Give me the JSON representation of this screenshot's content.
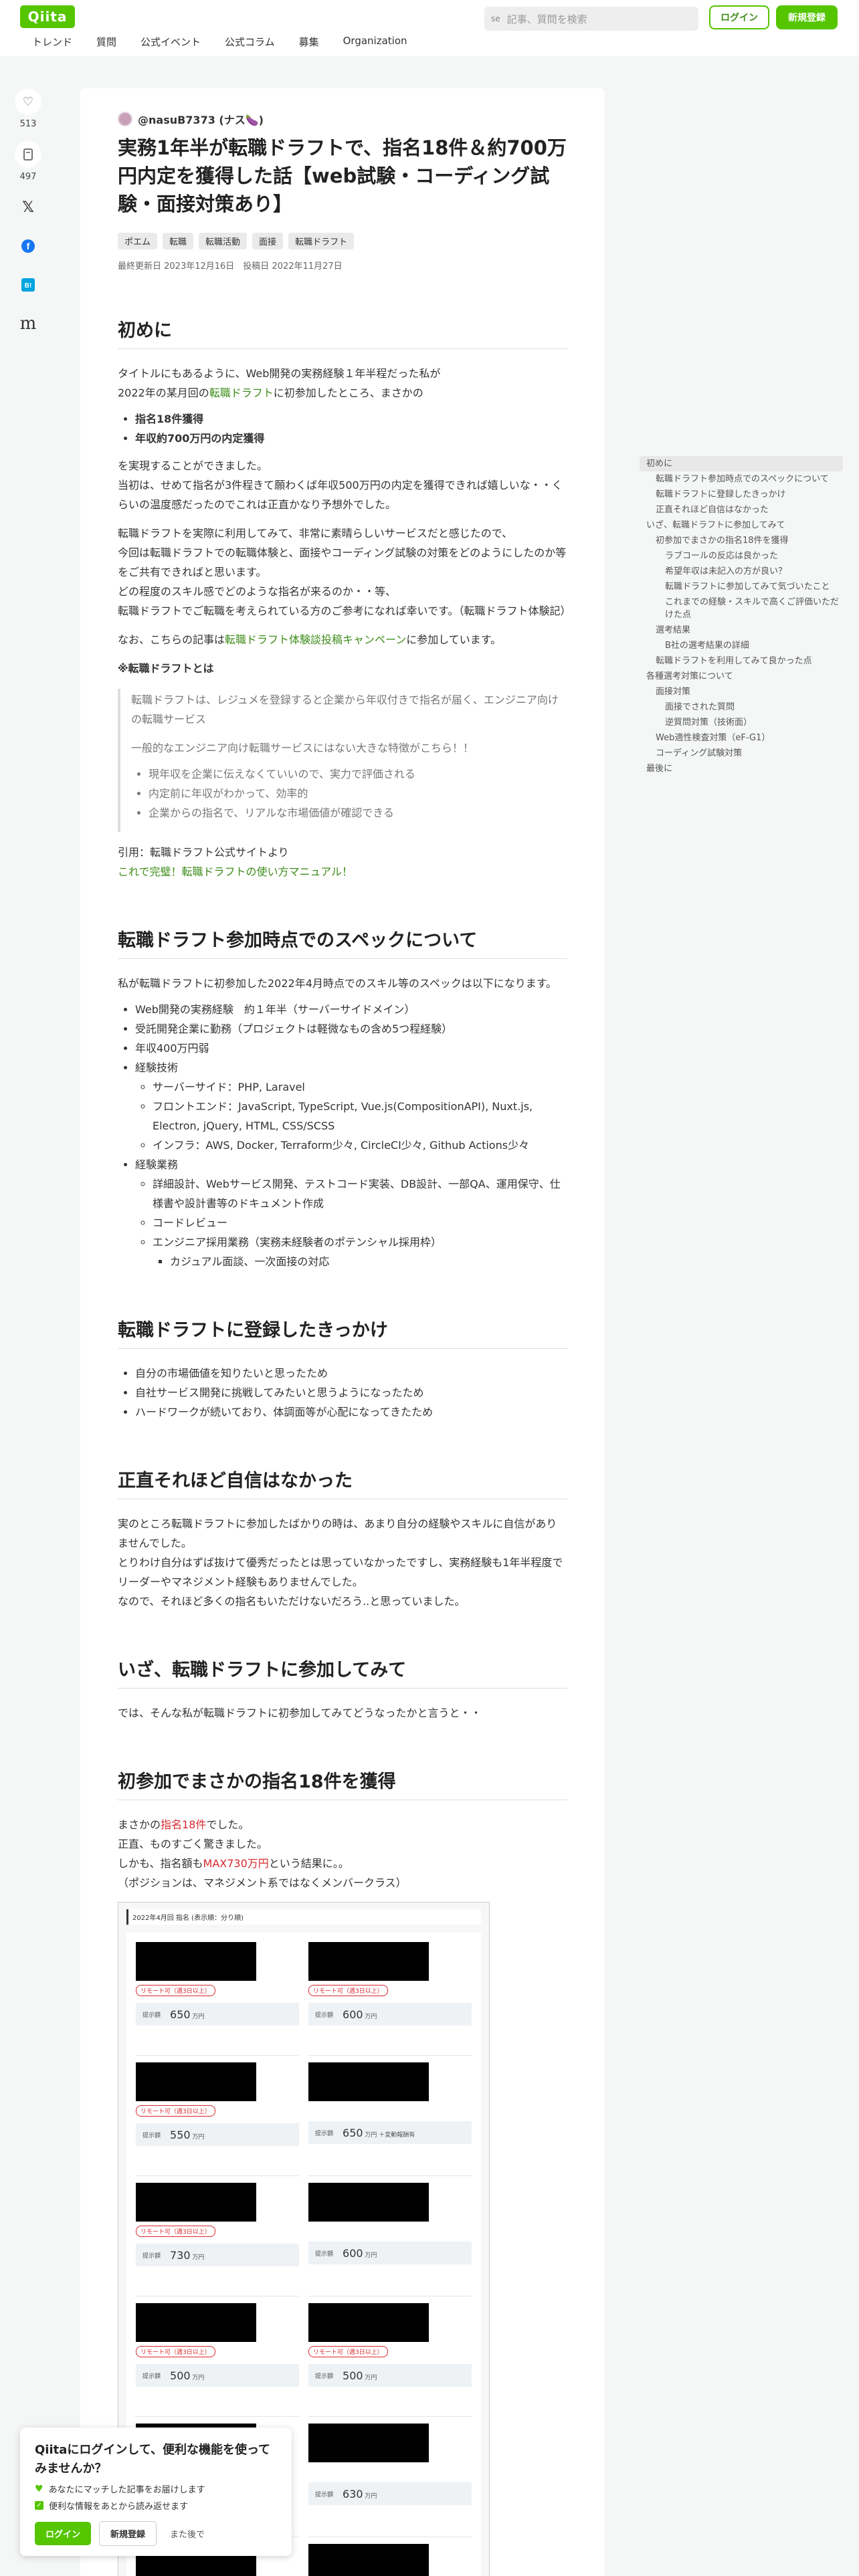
{
  "header": {
    "logo": "Qiita",
    "nav": [
      "トレンド",
      "質問",
      "公式イベント",
      "公式コラム",
      "募集",
      "Organization"
    ],
    "search_shortcut": "se",
    "search_placeholder": "記事、質問を検索",
    "login": "ログイン",
    "signup": "新規登録"
  },
  "actions": {
    "likes": "513",
    "stocks": "497"
  },
  "article": {
    "author": "@nasuB7373 (ナス🍆)",
    "title": "実務1年半が転職ドラフトで、指名18件＆約700万円内定を獲得した話【web試験・コーディング試験・面接対策あり】",
    "tags": [
      "ポエム",
      "転職",
      "転職活動",
      "面接",
      "転職ドラフト"
    ],
    "dates": "最終更新日 2023年12月16日　投稿日 2022年11月27日",
    "s1": {
      "heading": "初めに",
      "p1a": "タイトルにもあるように、Web開発の実務経験１年半程だった私が",
      "p1b_pre": "2022年の某月回の",
      "p1b_link": "転職ドラフト",
      "p1b_post": "に初参加したところ、まさかの",
      "bullets": [
        "指名18件獲得",
        "年収約700万円の内定獲得"
      ],
      "p2a": "を実現することができました。",
      "p2b": "当初は、せめて指名が3件程きて願わくば年収500万円の内定を獲得できれば嬉しいな・・くらいの温度感だったのでこれは正直かなり予想外でした。",
      "p3a": "転職ドラフトを実際に利用してみて、非常に素晴らしいサービスだと感じたので、",
      "p3b": "今回は転職ドラフトでの転職体験と、面接やコーディング試験の対策をどのようにしたのか等をご共有できればと思います。",
      "p3c": "どの程度のスキル感でどのような指名が来るのか・・等、",
      "p3d": "転職ドラフトでご転職を考えられている方のご参考になれば幸いです。（転職ドラフト体験記）",
      "p4_pre": "なお、こちらの記事は",
      "p4_link": "転職ドラフト体験談投稿キャンペーン",
      "p4_post": "に参加しています。",
      "what": "※転職ドラフトとは",
      "bq1": "転職ドラフトは、レジュメを登録すると企業から年収付きで指名が届く、エンジニア向けの転職サービス",
      "bq2": "一般的なエンジニア向け転職サービスにはない大きな特徴がこちら！！",
      "bq_bullets": [
        "現年収を企業に伝えなくていいので、実力で評価される",
        "内定前に年収がわかって、効率的",
        "企業からの指名で、リアルな市場価値が確認できる"
      ],
      "cite": "引用：転職ドラフト公式サイトより",
      "cite_link": "これで完璧！転職ドラフトの使い方マニュアル！"
    },
    "s2": {
      "heading": "転職ドラフト参加時点でのスペックについて",
      "intro": "私が転職ドラフトに初参加した2022年4月時点でのスキル等のスペックは以下になります。",
      "items": [
        "Web開発の実務経験　約１年半（サーバーサイドメイン）",
        "受託開発企業に勤務（プロジェクトは軽微なもの含め5つ程経験）",
        "年収400万円弱",
        "経験技術"
      ],
      "tech": [
        "サーバーサイド：PHP, Laravel",
        "フロントエンド：JavaScript, TypeScript, Vue.js(CompositionAPI), Nuxt.js, Electron, jQuery, HTML, CSS/SCSS",
        "インフラ：AWS, Docker, Terraform少々, CircleCI少々, Github Actions少々"
      ],
      "work": "経験業務",
      "work_items": [
        "詳細設計、Webサービス開発、テストコード実装、DB設計、一部QA、運用保守、仕様書や設計書等のドキュメント作成",
        "コードレビュー",
        "エンジニア採用業務（実務未経験者のポテンシャル採用枠）"
      ],
      "work_sub": "カジュアル面談、一次面接の対応"
    },
    "s3": {
      "heading": "転職ドラフトに登録したきっかけ",
      "items": [
        "自分の市場価値を知りたいと思ったため",
        "自社サービス開発に挑戦してみたいと思うようになったため",
        "ハードワークが続いており、体調面等が心配になってきたため"
      ]
    },
    "s4": {
      "heading": "正直それほど自信はなかった",
      "p1": "実のところ転職ドラフトに参加したばかりの時は、あまり自分の経験やスキルに自信がありませんでした。",
      "p2": "とりわけ自分はずば抜けて優秀だったとは思っていなかったですし、実務経験も1年半程度で",
      "p3": "リーダーやマネジメント経験もありませんでした。",
      "p4": "なので、それほど多くの指名もいただけないだろう..と思っていました。"
    },
    "s5": {
      "heading": "いざ、転職ドラフトに参加してみて",
      "p1": "では、そんな私が転職ドラフトに初参加してみてどうなったかと言うと・・"
    },
    "s6": {
      "heading": "初参加でまさかの指名18件を獲得",
      "p1_pre": "まさかの",
      "p1_red": "指名18件",
      "p1_post": "でした。",
      "p2": "正直、ものすごく驚きました。",
      "p3_pre": "しかも、指名額も",
      "p3_red": "MAX730万円",
      "p3_post": "という結果に。。",
      "p4": "（ポジションは、マネジメント系ではなくメンバークラス）"
    },
    "offer_image": {
      "header": "2022年4月回 指名 (表示順：分り順)",
      "badge": "リモート可（週3日以上）",
      "salary_label": "提示額",
      "unit": "万円",
      "note": "＋変動報酬有",
      "cards": [
        {
          "amount": "650",
          "note": false,
          "badge": true
        },
        {
          "amount": "600",
          "note": false,
          "badge": true
        },
        {
          "amount": "550",
          "note": false,
          "badge": true
        },
        {
          "amount": "650",
          "note": true,
          "badge": false
        },
        {
          "amount": "730",
          "note": false,
          "badge": true
        },
        {
          "amount": "600",
          "note": false,
          "badge": false
        },
        {
          "amount": "500",
          "note": false,
          "badge": true
        },
        {
          "amount": "500",
          "note": false,
          "badge": true
        },
        {
          "amount": "",
          "note": false,
          "badge": false
        },
        {
          "amount": "630",
          "note": false,
          "badge": false
        },
        {
          "amount": "",
          "note": false,
          "badge": true
        },
        {
          "amount": "",
          "note": false,
          "badge": true
        }
      ]
    }
  },
  "toc": [
    {
      "label": "初めに",
      "level": 1,
      "active": true
    },
    {
      "label": "転職ドラフト参加時点でのスペックについて",
      "level": 2
    },
    {
      "label": "転職ドラフトに登録したきっかけ",
      "level": 2
    },
    {
      "label": "正直それほど自信はなかった",
      "level": 2
    },
    {
      "label": "いざ、転職ドラフトに参加してみて",
      "level": 1
    },
    {
      "label": "初参加でまさかの指名18件を獲得",
      "level": 2
    },
    {
      "label": "ラブコールの反応は良かった",
      "level": 3
    },
    {
      "label": "希望年収は未記入の方が良い？",
      "level": 3
    },
    {
      "label": "転職ドラフトに参加してみて気づいたこと",
      "level": 3
    },
    {
      "label": "これまでの経験・スキルで高くご評価いただけた点",
      "level": 3
    },
    {
      "label": "選考結果",
      "level": 2
    },
    {
      "label": "B社の選考結果の詳細",
      "level": 3
    },
    {
      "label": "転職ドラフトを利用してみて良かった点",
      "level": 2
    },
    {
      "label": "各種選考対策について",
      "level": 1
    },
    {
      "label": "面接対策",
      "level": 2
    },
    {
      "label": "面接でされた質問",
      "level": 3
    },
    {
      "label": "逆質問対策（技術面）",
      "level": 3
    },
    {
      "label": "Web適性検査対策（eF-G1）",
      "level": 2
    },
    {
      "label": "コーディング試験対策",
      "level": 2
    },
    {
      "label": "最後に",
      "level": 1
    }
  ],
  "popup": {
    "title": "Qiitaにログインして、便利な機能を使ってみませんか？",
    "b1": "あなたにマッチした記事をお届けします",
    "b2": "便利な情報をあとから読み返せます",
    "login": "ログイン",
    "signup": "新規登録",
    "later": "また後で"
  }
}
